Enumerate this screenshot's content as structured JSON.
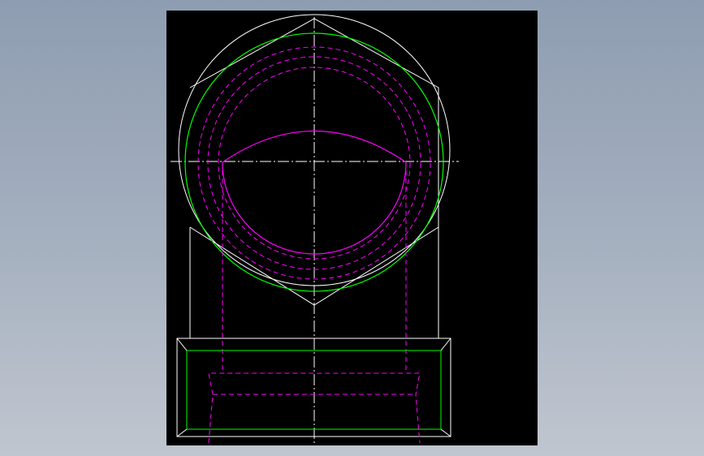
{
  "colors": {
    "background_top": "#8e9db1",
    "background_bottom": "#c0c6cf",
    "viewport": "#000000",
    "outline": "#ffffff",
    "hidden_lines": "#ff00ff",
    "thread_circle": "#00ff00",
    "centerline": "#ffffff"
  },
  "drawing": {
    "views": [
      "top-hex-view",
      "front-base-view"
    ],
    "line_types": [
      "visible",
      "hidden-dashed",
      "center-dash-dot"
    ],
    "icons": {
      "viewport": "cad-drawing-icon"
    }
  }
}
